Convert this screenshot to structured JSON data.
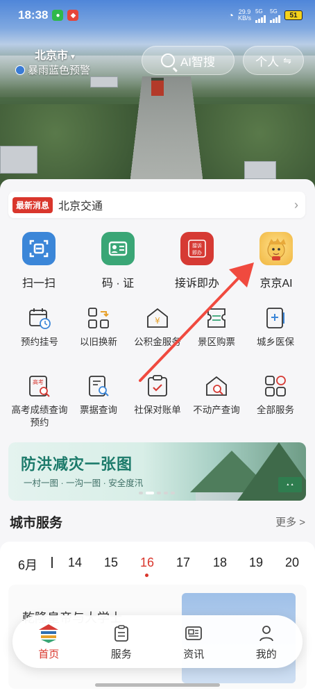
{
  "status_bar": {
    "time": "18:38",
    "net_speed_top": "29.9",
    "net_speed_unit": "KB/s",
    "sig1": "5G",
    "sig2": "5G",
    "battery": "51"
  },
  "header": {
    "city": "北京市",
    "warning": "暴雨蓝色预警",
    "ai_search": "AI智搜",
    "personal": "个人"
  },
  "news": {
    "tag": "最新消息",
    "text": "北京交通"
  },
  "big_services": [
    {
      "label": "扫一扫",
      "icon": "scan-icon",
      "color": "#3b86d8"
    },
    {
      "label": "码 · 证",
      "icon": "id-card-icon",
      "color": "#3aa676"
    },
    {
      "label": "接诉即办",
      "icon": "complaint-icon",
      "color": "#d63a34"
    },
    {
      "label": "京京AI",
      "icon": "mascot-icon",
      "color": "#f2b53a"
    }
  ],
  "small_services": [
    {
      "label": "预约挂号",
      "icon": "calendar-clock-icon"
    },
    {
      "label": "以旧换新",
      "icon": "exchange-icon"
    },
    {
      "label": "公积金服务",
      "icon": "housing-fund-icon"
    },
    {
      "label": "景区购票",
      "icon": "ticket-icon"
    },
    {
      "label": "城乡医保",
      "icon": "medical-insurance-icon"
    },
    {
      "label": "高考成绩查询预约",
      "icon": "exam-score-icon"
    },
    {
      "label": "票据查询",
      "icon": "receipt-search-icon"
    },
    {
      "label": "社保对账单",
      "icon": "social-security-icon"
    },
    {
      "label": "不动产查询",
      "icon": "real-estate-icon"
    },
    {
      "label": "全部服务",
      "icon": "all-services-icon"
    }
  ],
  "banner": {
    "title": "防洪减灾一张图",
    "subtitle": "一村一图 · 一沟一图 · 安全度汛"
  },
  "city_services": {
    "title": "城市服务",
    "more": "更多 >"
  },
  "calendar": {
    "month": "6月",
    "days": [
      "14",
      "15",
      "16",
      "17",
      "18",
      "19",
      "20"
    ],
    "active_day": "16"
  },
  "article": {
    "title": "乾隆皇帝与大学士"
  },
  "bottom_nav": [
    {
      "label": "首页",
      "icon": "home-logo-icon"
    },
    {
      "label": "服务",
      "icon": "service-icon"
    },
    {
      "label": "资讯",
      "icon": "news-icon"
    },
    {
      "label": "我的",
      "icon": "profile-icon"
    }
  ],
  "colors": {
    "accent": "#d9362c",
    "annotation_arrow": "#f04a3f"
  }
}
